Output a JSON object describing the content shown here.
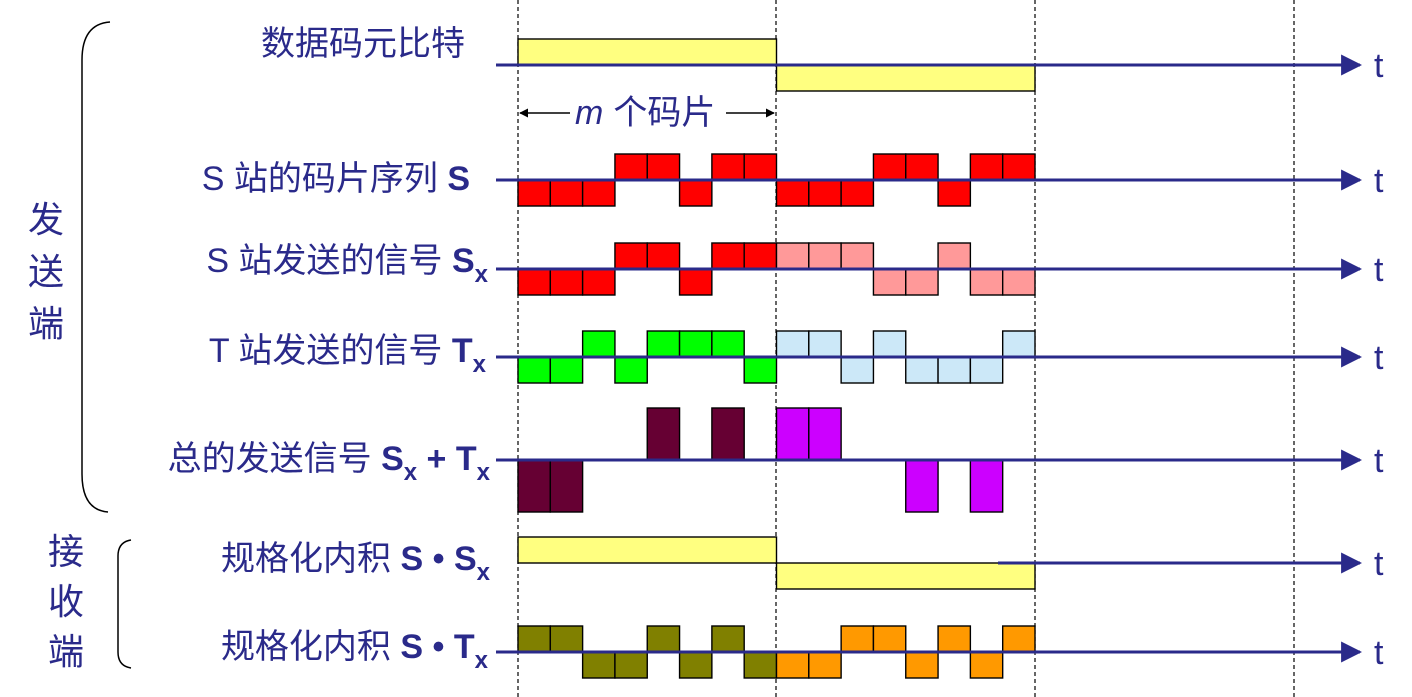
{
  "labels": {
    "side_send": [
      "发",
      "送",
      "端"
    ],
    "side_recv": [
      "接",
      "收",
      "端"
    ],
    "m_chips": "个码片",
    "m_var": "m",
    "t": "t"
  },
  "rows": [
    {
      "id": "data-bits",
      "parts": [
        {
          "t": "数据码元比特"
        }
      ]
    },
    {
      "id": "s-chip-seq",
      "parts": [
        {
          "t": "S 站的码片序列 "
        },
        {
          "t": "S",
          "b": true
        }
      ]
    },
    {
      "id": "s-signal",
      "parts": [
        {
          "t": "S 站发送的信号 "
        },
        {
          "t": "S",
          "b": true
        },
        {
          "t": "x",
          "b": true,
          "sub": true
        }
      ]
    },
    {
      "id": "t-signal",
      "parts": [
        {
          "t": "T 站发送的信号 "
        },
        {
          "t": "T",
          "b": true
        },
        {
          "t": "x",
          "b": true,
          "sub": true
        }
      ]
    },
    {
      "id": "total-signal",
      "parts": [
        {
          "t": "总的发送信号 "
        },
        {
          "t": "S",
          "b": true
        },
        {
          "t": "x",
          "b": true,
          "sub": true
        },
        {
          "t": " + ",
          "b": true
        },
        {
          "t": "T",
          "b": true
        },
        {
          "t": "x",
          "b": true,
          "sub": true
        }
      ]
    },
    {
      "id": "inner-s-sx",
      "parts": [
        {
          "t": "规格化内积 "
        },
        {
          "t": "S • S",
          "b": true
        },
        {
          "t": "x",
          "b": true,
          "sub": true
        }
      ]
    },
    {
      "id": "inner-s-tx",
      "parts": [
        {
          "t": "规格化内积 "
        },
        {
          "t": "S • T",
          "b": true
        },
        {
          "t": "x",
          "b": true,
          "sub": true
        }
      ]
    }
  ],
  "chip_data": {
    "chips_per_bit": 8,
    "data_bits": [
      1,
      0
    ],
    "s_chip_sequence": [
      -1,
      -1,
      -1,
      1,
      1,
      -1,
      1,
      1
    ],
    "t_chip_sequence": [
      -1,
      -1,
      1,
      -1,
      1,
      1,
      1,
      -1
    ],
    "colors": {
      "data": "#ffff80",
      "s_bit1": "#ff0000",
      "s_bit0": "#ff9999",
      "t_bit1": "#00ff00",
      "t_bit0": "#cce8f8",
      "sum_bit1": "#660033",
      "sum_bit0": "#cc00ff",
      "inner_bit1": "#808000",
      "inner_bit0": "#ff9900",
      "axis": "#2a2a8a"
    }
  }
}
